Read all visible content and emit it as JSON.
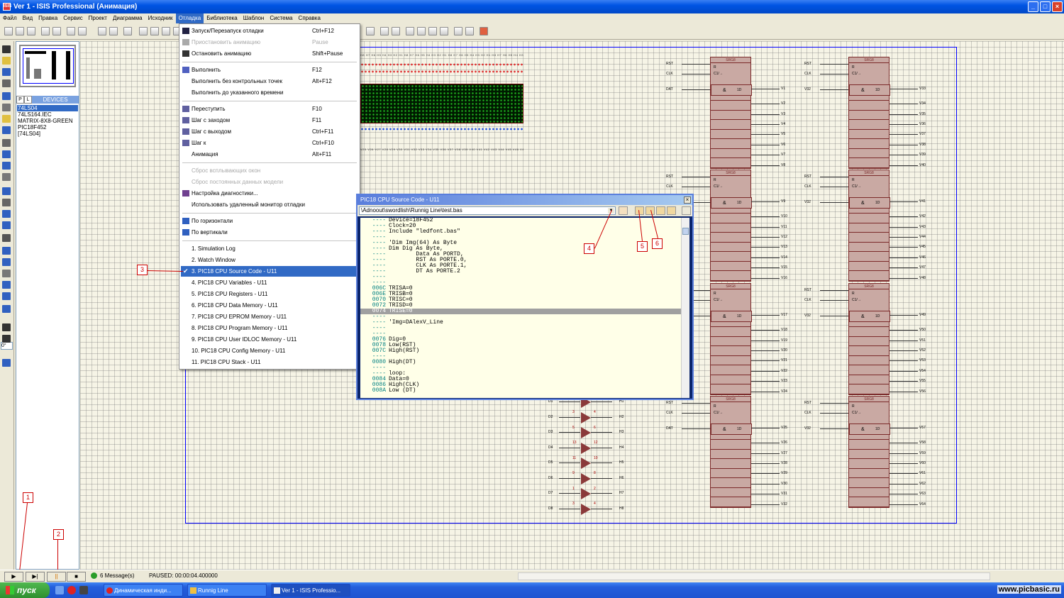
{
  "window": {
    "title": "Ver 1 - ISIS Professional (Анимация)",
    "app_icon_text": "ISIS"
  },
  "menubar": [
    "Файл",
    "Вид",
    "Правка",
    "Сервис",
    "Проект",
    "Диаграмма",
    "Исходник",
    "Отладка",
    "Библиотека",
    "Шаблон",
    "Система",
    "Справка"
  ],
  "device_panel": {
    "tab_p": "P",
    "tab_l": "L",
    "header": "DEVICES",
    "devices": [
      "74LS04",
      "74LS164.IEC",
      "MATRIX-8X8-GREEN",
      "PIC18F452",
      "[74LS04]"
    ]
  },
  "left_tool_input_value": "0°",
  "debug_menu": {
    "items": [
      {
        "label": "Запуск/Перезапуск отладки",
        "shortcut": "Ctrl+F12",
        "disabled": false
      },
      {
        "label": "Приостановить анимацию",
        "shortcut": "Pause",
        "disabled": true
      },
      {
        "label": "Остановить анимацию",
        "shortcut": "Shift+Pause",
        "disabled": false
      },
      {
        "label": "Выполнить",
        "shortcut": "F12",
        "disabled": false
      },
      {
        "label": "Выполнить без контрольных точек",
        "shortcut": "Alt+F12",
        "disabled": false
      },
      {
        "label": "Выполнить до указанного времени",
        "shortcut": "",
        "disabled": false
      },
      {
        "label": "Переступить",
        "shortcut": "F10",
        "disabled": false
      },
      {
        "label": "Шаг с заходом",
        "shortcut": "F11",
        "disabled": false
      },
      {
        "label": "Шаг с выходом",
        "shortcut": "Ctrl+F11",
        "disabled": false
      },
      {
        "label": "Шаг к",
        "shortcut": "Ctrl+F10",
        "disabled": false
      },
      {
        "label": "Анимация",
        "shortcut": "Alt+F11",
        "disabled": false
      },
      {
        "label": "Сброс всплывающих окон",
        "shortcut": "",
        "disabled": true
      },
      {
        "label": "Сброс постоянных данных модели",
        "shortcut": "",
        "disabled": true
      },
      {
        "label": "Настройка диагностики...",
        "shortcut": "",
        "disabled": false
      },
      {
        "label": "Использовать удаленный монитор отладки",
        "shortcut": "",
        "disabled": false
      },
      {
        "label": "По горизонтали",
        "shortcut": "",
        "disabled": false
      },
      {
        "label": "По вертикали",
        "shortcut": "",
        "disabled": false
      },
      {
        "label": "1. Simulation Log",
        "shortcut": "",
        "disabled": false
      },
      {
        "label": "2. Watch Window",
        "shortcut": "",
        "disabled": false
      },
      {
        "label": "3. PIC18 CPU Source Code - U11",
        "shortcut": "",
        "disabled": false,
        "checked": true,
        "highlighted": true
      },
      {
        "label": "4. PIC18 CPU Variables - U11",
        "shortcut": "",
        "disabled": false
      },
      {
        "label": "5. PIC18 CPU Registers - U11",
        "shortcut": "",
        "disabled": false
      },
      {
        "label": "6. PIC18 CPU Data Memory - U11",
        "shortcut": "",
        "disabled": false
      },
      {
        "label": "7. PIC18 CPU EPROM Memory - U11",
        "shortcut": "",
        "disabled": false
      },
      {
        "label": "8. PIC18 CPU Program Memory - U11",
        "shortcut": "",
        "disabled": false
      },
      {
        "label": "9. PIC18 CPU User IDLOC Memory - U11",
        "shortcut": "",
        "disabled": false
      },
      {
        "label": "10. PIC18 CPU Config Memory - U11",
        "shortcut": "",
        "disabled": false
      },
      {
        "label": "11. PIC18 CPU Stack - U11",
        "shortcut": "",
        "disabled": false
      }
    ]
  },
  "source_window": {
    "title": "PIC18 CPU Source Code - U11",
    "close": "×",
    "path": "\\Adnoout\\swordlish\\Runnig Line\\test.bas",
    "lines": [
      {
        "addr": "----",
        "code": "Device=18F452"
      },
      {
        "addr": "----",
        "code": "Clock=20"
      },
      {
        "addr": "----",
        "code": "Include \"ledfont.bas\""
      },
      {
        "addr": "----",
        "code": ""
      },
      {
        "addr": "----",
        "code": "'Dim Img(64) As Byte"
      },
      {
        "addr": "----",
        "code": "Dim Dig As Byte,"
      },
      {
        "addr": "----",
        "code": "        Data As PORTD,"
      },
      {
        "addr": "----",
        "code": "        RST As PORTE.0,"
      },
      {
        "addr": "----",
        "code": "        CLK As PORTE.1,"
      },
      {
        "addr": "----",
        "code": "        DT As PORTE.2"
      },
      {
        "addr": "----",
        "code": ""
      },
      {
        "addr": "----",
        "code": ""
      },
      {
        "addr": "006C",
        "code": "TRISA=0"
      },
      {
        "addr": "006E",
        "code": "TRISB=0"
      },
      {
        "addr": "0070",
        "code": "TRISC=0"
      },
      {
        "addr": "0072",
        "code": "TRISD=0"
      },
      {
        "addr": "0074",
        "code": "TRISE=0",
        "current": true
      },
      {
        "addr": "----",
        "code": ""
      },
      {
        "addr": "----",
        "code": "'Img=DAlexV_Line"
      },
      {
        "addr": "----",
        "code": ""
      },
      {
        "addr": "----",
        "code": ""
      },
      {
        "addr": "0076",
        "code": "Dig=0"
      },
      {
        "addr": "0078",
        "code": "Low(RST)"
      },
      {
        "addr": "007C",
        "code": "High(RST)"
      },
      {
        "addr": "----",
        "code": ""
      },
      {
        "addr": "0080",
        "code": "High(DT)"
      },
      {
        "addr": "----",
        "code": ""
      },
      {
        "addr": "----",
        "code": "loop:"
      },
      {
        "addr": "0084",
        "code": "Data=0"
      },
      {
        "addr": "0086",
        "code": "High(CLK)"
      },
      {
        "addr": "008A",
        "code": "Low (DT)"
      }
    ]
  },
  "callouts": [
    "1",
    "2",
    "3",
    "4",
    "5",
    "6"
  ],
  "schematic": {
    "chip_label": "SRG8",
    "pin_r": "R",
    "pin_c1": "C1/→",
    "pin_amp": "&",
    "pin_1d": "1D",
    "left_labels_a": [
      "RST",
      "CLK",
      "DAT"
    ],
    "left_labels_b": [
      "RST",
      "CLK",
      "V32"
    ],
    "outputs_col1": [
      "V1",
      "V2",
      "V3",
      "V4",
      "V5",
      "V6",
      "V7",
      "V8",
      "V9",
      "V10",
      "V11",
      "V12",
      "V13",
      "V14",
      "V15",
      "V16",
      "V17",
      "V18",
      "V19",
      "V20",
      "V21",
      "V22",
      "V23",
      "V24",
      "V25",
      "V26",
      "V27",
      "V28",
      "V29",
      "V30",
      "V31",
      "V32"
    ],
    "outputs_col2": [
      "V33",
      "V34",
      "V35",
      "V36",
      "V37",
      "V38",
      "V39",
      "V40",
      "V41",
      "V42",
      "V43",
      "V44",
      "V45",
      "V46",
      "V47",
      "V48",
      "V49",
      "V50",
      "V51",
      "V52",
      "V53",
      "V54",
      "V55",
      "V56",
      "V57",
      "V58",
      "V59",
      "V60",
      "V61",
      "V62",
      "V63",
      "V64"
    ],
    "d_labels": [
      "D1",
      "D2",
      "D3",
      "D4",
      "D5",
      "D6",
      "D7",
      "D8"
    ],
    "h_labels": [
      "H1",
      "H2",
      "H3",
      "H4",
      "H5",
      "H6",
      "H7",
      "H8"
    ],
    "buffer_pins_in": [
      "3",
      "5",
      "13",
      "11",
      "9",
      "1",
      "3"
    ],
    "buffer_pins_out": [
      "4",
      "6",
      "12",
      "10",
      "8",
      "2",
      "4"
    ],
    "matrix_top_labels": "H8 H7 H6 H5 H4 H3 H2 H1 H8 H7 H6 H5 H4 H3 H2 H1 H8 H7 H6 H5 H4 H3 H2 H1 H8 H7 H6 H5 H4 H3 H2 H1 H8 H7 H6 H5 H4 H3 H2 H1 H8 H7 H6 H5",
    "matrix_bottom_labels": "V25 V26 V27 V28 V29 V30 V31 V32 V33 V34 V35 V36 V37 V38 V39 V40 V41 V42 V43 V44 V45 V46 V47 V48 V49 V50 V51 V52 V53 V54 V55"
  },
  "statusbar": {
    "messages": "6 Message(s)",
    "status": "PAUSED: 00:00:04.400000"
  },
  "taskbar": {
    "start": "пуск",
    "items": [
      "Динамическая инди...",
      "Runnig Line",
      "Ver 1 - ISIS Professio..."
    ],
    "watermark": "www.picbasic.ru"
  },
  "colors": {
    "titlebar": "#0054e3",
    "menu_highlight": "#316ac5",
    "chip_fill": "#c9a9a3",
    "chip_border": "#7b2a2a",
    "callout": "#cc0000",
    "code_address": "#008080"
  }
}
